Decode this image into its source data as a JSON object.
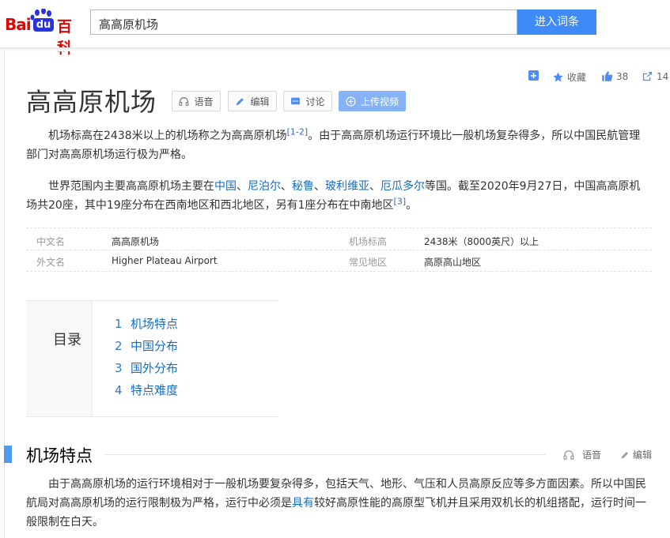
{
  "header": {
    "logo": {
      "bai": "Bai",
      "du": "du",
      "baike": "百科"
    },
    "search_value": "高高原机场",
    "search_button": "进入词条"
  },
  "toolbar": {
    "favorite_label": "收藏",
    "like_count": "38",
    "share_count": "14"
  },
  "title": {
    "text": "高高原机场",
    "buttons": {
      "voice": "语音",
      "edit": "编辑",
      "discuss": "讨论",
      "upload_video": "上传视频"
    }
  },
  "intro": {
    "p1": {
      "text_before": "机场标高在2438米以上的机场称之为高高原机场",
      "ref": "[1-2]",
      "text_after": "。由于高高原机场运行环境比一般机场复杂得多，所以中国民航管理部门对高高原机场运行极为严格。"
    },
    "p2": {
      "text_a": "世界范围内主要高高原机场主要在",
      "links": [
        "中国",
        "尼泊尔",
        "秘鲁",
        "玻利维亚",
        "厄瓜多尔"
      ],
      "separator": "、",
      "text_b": "等国。截至2020年9月27日，中国高高原机场共20座，其中19座分布在西南地区和西北地区，另有1座分布在中南地区",
      "ref": "[3]",
      "text_c": "。"
    }
  },
  "infobox": {
    "rows": [
      {
        "k1": "中文名",
        "v1": "高高原机场",
        "k2": "机场标高",
        "v2": "2438米（8000英尺）以上"
      },
      {
        "k1": "外文名",
        "v1": "Higher Plateau Airport",
        "k2": "常见地区",
        "v2": "高原高山地区"
      }
    ]
  },
  "toc": {
    "title": "目录",
    "items": [
      {
        "num": "1",
        "label": "机场特点"
      },
      {
        "num": "2",
        "label": "中国分布"
      },
      {
        "num": "3",
        "label": "国外分布"
      },
      {
        "num": "4",
        "label": "特点难度"
      }
    ]
  },
  "section": {
    "title": "机场特点",
    "voice": "语音",
    "edit": "编辑",
    "para": {
      "text_a": "由于高高原机场的运行环境相对于一般机场要复杂得多，包括天气、地形、气压和人员高原反应等多方面因素。所以中国民航局对高高原机场的运行限制极为严格，运行中必须是",
      "link": "具有",
      "text_b": "较好高原性能的高原型飞机并且采用双机长的机组搭配，运行时间一般限制在白天。"
    }
  },
  "colors": {
    "brand_red": "#e10601",
    "brand_blue": "#2932e1",
    "link": "#136ec2",
    "accent": "#3e8af7"
  }
}
